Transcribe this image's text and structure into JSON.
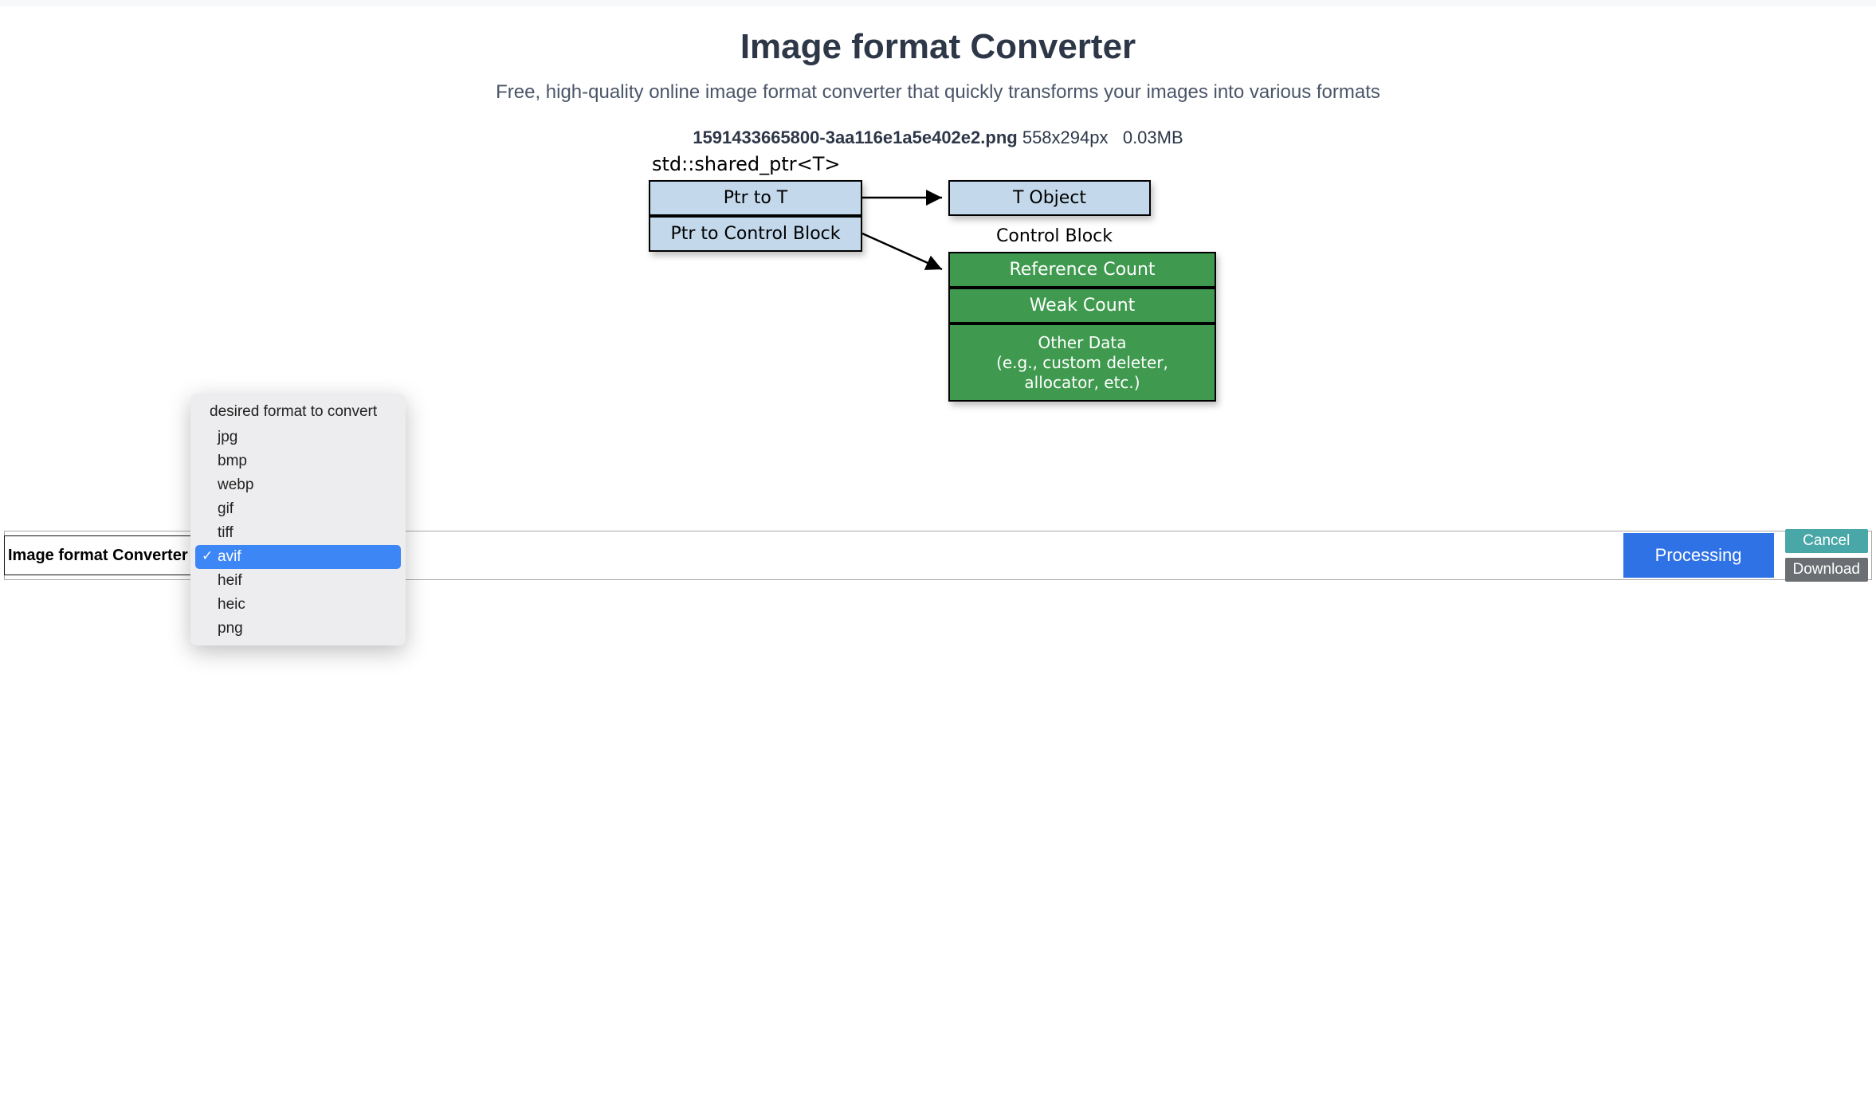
{
  "page": {
    "title": "Image format Converter",
    "subtitle": "Free, high-quality online image format converter that quickly transforms your images into various formats"
  },
  "file": {
    "name": "1591433665800-3aa116e1a5e402e2.png",
    "dimensions": "558x294px",
    "size": "0.03MB"
  },
  "diagram": {
    "caption": "std::shared_ptr<T>",
    "left_rows": [
      "Ptr to T",
      "Ptr to Control Block"
    ],
    "right_top": "T Object",
    "cb_label": "Control Block",
    "cb_rows": [
      "Reference Count",
      "Weak Count"
    ],
    "cb_other": "Other Data\n(e.g., custom deleter,\nallocator, etc.)"
  },
  "convbar": {
    "label": "Image format Converter",
    "processing_label": "Processing",
    "cancel_label": "Cancel",
    "download_label": "Download"
  },
  "dropdown": {
    "header": "desired format to convert",
    "options": [
      "jpg",
      "bmp",
      "webp",
      "gif",
      "tiff",
      "avif",
      "heif",
      "heic",
      "png"
    ],
    "selected": "avif"
  }
}
